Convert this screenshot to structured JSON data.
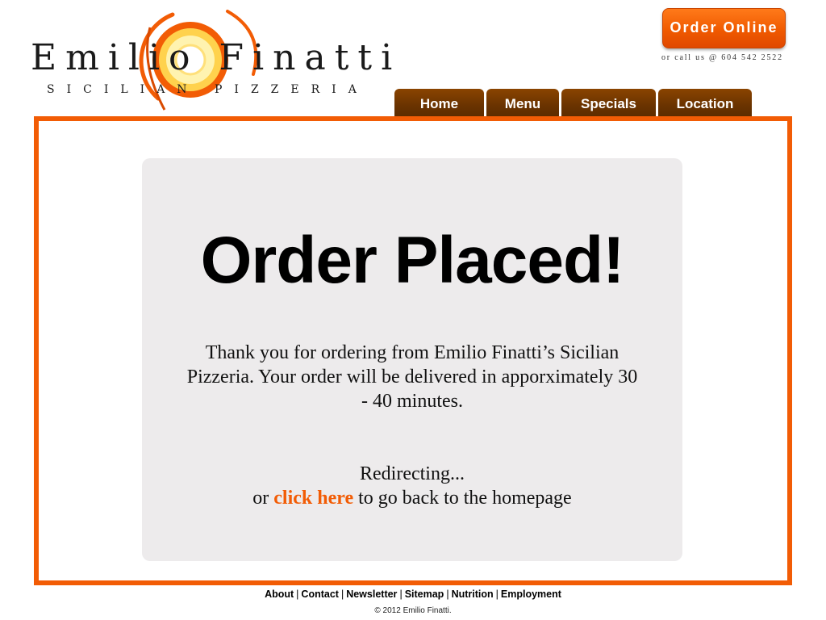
{
  "brand": {
    "name": "Emilio Finatti",
    "tagline": "Sicilian Pizzeria",
    "logo_icon": "sun-swirl-icon",
    "colors": {
      "accent": "#f25c05",
      "nav": "#6a3300",
      "card": "#edebec"
    }
  },
  "header": {
    "order_button_label": "Order Online",
    "call_text": "or call us @ 604 542 2522"
  },
  "nav": {
    "items": [
      {
        "label": "Home"
      },
      {
        "label": "Menu"
      },
      {
        "label": "Specials"
      },
      {
        "label": "Location"
      }
    ]
  },
  "main": {
    "headline": "Order Placed!",
    "message": "Thank you for ordering from Emilio Finatti’s Sicilian Pizzeria.  Your order will be delivered in apporximately 30 - 40 minutes.",
    "redirect_text": "Redirecting...",
    "link_prefix": "or",
    "link_label": "click here",
    "link_suffix": "to go back to the homepage"
  },
  "footer": {
    "links": [
      "About",
      "Contact",
      "Newsletter",
      "Sitemap",
      "Nutrition",
      "Employment"
    ],
    "copyright": "© 2012 Emilio Finatti."
  }
}
